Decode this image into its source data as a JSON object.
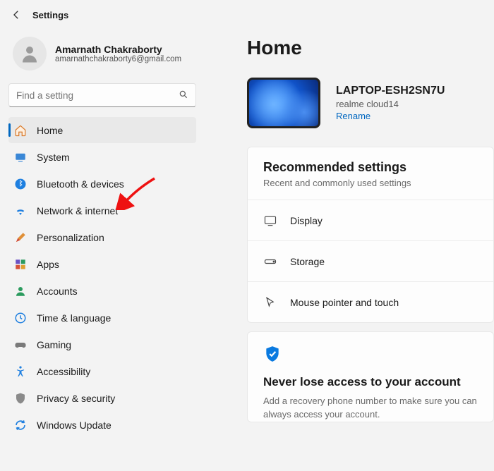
{
  "app": {
    "title": "Settings"
  },
  "user": {
    "name": "Amarnath Chakraborty",
    "email": "amarnathchakraborty6@gmail.com"
  },
  "search": {
    "placeholder": "Find a setting"
  },
  "nav": {
    "home": {
      "label": "Home"
    },
    "system": {
      "label": "System"
    },
    "bluetooth": {
      "label": "Bluetooth & devices"
    },
    "network": {
      "label": "Network & internet"
    },
    "personalization": {
      "label": "Personalization"
    },
    "apps": {
      "label": "Apps"
    },
    "accounts": {
      "label": "Accounts"
    },
    "time": {
      "label": "Time & language"
    },
    "gaming": {
      "label": "Gaming"
    },
    "accessibility": {
      "label": "Accessibility"
    },
    "privacy": {
      "label": "Privacy & security"
    },
    "update": {
      "label": "Windows Update"
    }
  },
  "page": {
    "heading": "Home"
  },
  "device": {
    "name": "LAPTOP-ESH2SN7U",
    "subtitle": "realme cloud14",
    "rename": "Rename"
  },
  "recommended": {
    "title": "Recommended settings",
    "subtitle": "Recent and commonly used settings",
    "row1": "Display",
    "row2": "Storage",
    "row3": "Mouse pointer and touch"
  },
  "recovery": {
    "title": "Never lose access to your account",
    "desc": "Add a recovery phone number to make sure you can always access your account."
  },
  "colors": {
    "accent": "#0067c0"
  }
}
